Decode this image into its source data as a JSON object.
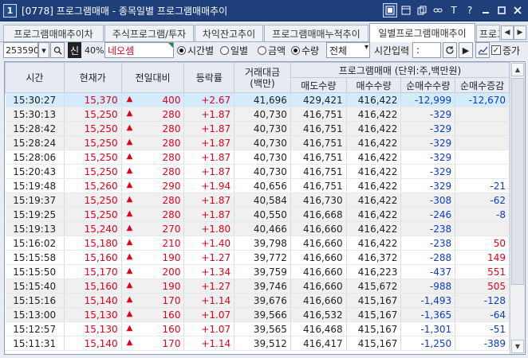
{
  "window": {
    "number": "1",
    "title": "[0778] 프로그램매매 - 종목일별 프로그램매매추이",
    "icons": [
      "restore-icon",
      "window-icon",
      "copy-icon",
      "link-icon",
      "font-icon",
      "help-icon",
      "minimize-icon",
      "maximize-icon",
      "close-icon"
    ],
    "icon_glyphs": {
      "font": "T",
      "help": "?"
    }
  },
  "tabs": [
    {
      "label": "프로그램매매추이차"
    },
    {
      "label": "주식프로그램/투자"
    },
    {
      "label": "차익잔고추이"
    },
    {
      "label": "프로그램매매누적추이"
    },
    {
      "label": "일별프로그램매매추이",
      "active": true
    },
    {
      "label": "프로그"
    }
  ],
  "toolbar": {
    "code": "253590",
    "credit_badge": "신",
    "ratio": "40%",
    "stock_name": "네오셈",
    "radio_time": "시간별",
    "radio_day": "일별",
    "radio_amount": "금액",
    "radio_qty": "수량",
    "filter_value": "전체",
    "time_input_label": "시간입력",
    "time_value": " :",
    "increase_label": "증가"
  },
  "grid": {
    "headers": {
      "time": "시간",
      "price": "현재가",
      "change": "전일대비",
      "rate": "등락률",
      "turnover": "거래대금\n(백만)",
      "program_group": "프로그램매매 (단위:주,백만원)",
      "sell_qty": "매도수량",
      "buy_qty": "매수수량",
      "net_qty": "순매수수량",
      "net_change": "순매수증감"
    },
    "rows": [
      {
        "time": "15:30:27",
        "price": "15,370",
        "change": "400",
        "rate": "+2.67",
        "turnover": "41,696",
        "sell": "429,421",
        "buy": "416,422",
        "net": "-12,999",
        "net_chg": "-12,670"
      },
      {
        "time": "15:30:13",
        "price": "15,250",
        "change": "280",
        "rate": "+1.87",
        "turnover": "40,730",
        "sell": "416,751",
        "buy": "416,422",
        "net": "-329",
        "net_chg": ""
      },
      {
        "time": "15:28:42",
        "price": "15,250",
        "change": "280",
        "rate": "+1.87",
        "turnover": "40,730",
        "sell": "416,751",
        "buy": "416,422",
        "net": "-329",
        "net_chg": ""
      },
      {
        "time": "15:28:24",
        "price": "15,250",
        "change": "280",
        "rate": "+1.87",
        "turnover": "40,730",
        "sell": "416,751",
        "buy": "416,422",
        "net": "-329",
        "net_chg": ""
      },
      {
        "time": "15:28:06",
        "price": "15,250",
        "change": "280",
        "rate": "+1.87",
        "turnover": "40,730",
        "sell": "416,751",
        "buy": "416,422",
        "net": "-329",
        "net_chg": ""
      },
      {
        "time": "15:20:43",
        "price": "15,250",
        "change": "280",
        "rate": "+1.87",
        "turnover": "40,730",
        "sell": "416,751",
        "buy": "416,422",
        "net": "-329",
        "net_chg": ""
      },
      {
        "time": "15:19:48",
        "price": "15,260",
        "change": "290",
        "rate": "+1.94",
        "turnover": "40,656",
        "sell": "416,751",
        "buy": "416,422",
        "net": "-329",
        "net_chg": "-21"
      },
      {
        "time": "15:19:37",
        "price": "15,250",
        "change": "280",
        "rate": "+1.87",
        "turnover": "40,584",
        "sell": "416,730",
        "buy": "416,422",
        "net": "-308",
        "net_chg": "-62"
      },
      {
        "time": "15:19:25",
        "price": "15,250",
        "change": "280",
        "rate": "+1.87",
        "turnover": "40,550",
        "sell": "416,668",
        "buy": "416,422",
        "net": "-246",
        "net_chg": "-8"
      },
      {
        "time": "15:19:13",
        "price": "15,240",
        "change": "270",
        "rate": "+1.80",
        "turnover": "40,466",
        "sell": "416,660",
        "buy": "416,422",
        "net": "-238",
        "net_chg": ""
      },
      {
        "time": "15:16:02",
        "price": "15,180",
        "change": "210",
        "rate": "+1.40",
        "turnover": "39,798",
        "sell": "416,660",
        "buy": "416,422",
        "net": "-238",
        "net_chg": "50"
      },
      {
        "time": "15:15:58",
        "price": "15,160",
        "change": "190",
        "rate": "+1.27",
        "turnover": "39,772",
        "sell": "416,660",
        "buy": "416,372",
        "net": "-288",
        "net_chg": "149"
      },
      {
        "time": "15:15:50",
        "price": "15,170",
        "change": "200",
        "rate": "+1.34",
        "turnover": "39,759",
        "sell": "416,660",
        "buy": "416,223",
        "net": "-437",
        "net_chg": "551"
      },
      {
        "time": "15:15:40",
        "price": "15,160",
        "change": "190",
        "rate": "+1.27",
        "turnover": "39,746",
        "sell": "416,660",
        "buy": "415,672",
        "net": "-988",
        "net_chg": "505"
      },
      {
        "time": "15:15:16",
        "price": "15,140",
        "change": "170",
        "rate": "+1.14",
        "turnover": "39,676",
        "sell": "416,660",
        "buy": "415,167",
        "net": "-1,493",
        "net_chg": "-128"
      },
      {
        "time": "15:13:00",
        "price": "15,130",
        "change": "160",
        "rate": "+1.07",
        "turnover": "39,566",
        "sell": "416,532",
        "buy": "415,167",
        "net": "-1,365",
        "net_chg": "-64"
      },
      {
        "time": "15:12:57",
        "price": "15,130",
        "change": "160",
        "rate": "+1.07",
        "turnover": "39,565",
        "sell": "416,468",
        "buy": "415,167",
        "net": "-1,301",
        "net_chg": "-51"
      },
      {
        "time": "15:11:31",
        "price": "15,140",
        "change": "170",
        "rate": "+1.14",
        "turnover": "39,512",
        "sell": "416,417",
        "buy": "415,167",
        "net": "-1,250",
        "net_chg": "-389"
      }
    ]
  },
  "colors": {
    "up": "#e0001b",
    "down": "#0a3cc9",
    "titlebar": "#1f3f7a",
    "selected_row": "#d4ebfb"
  }
}
